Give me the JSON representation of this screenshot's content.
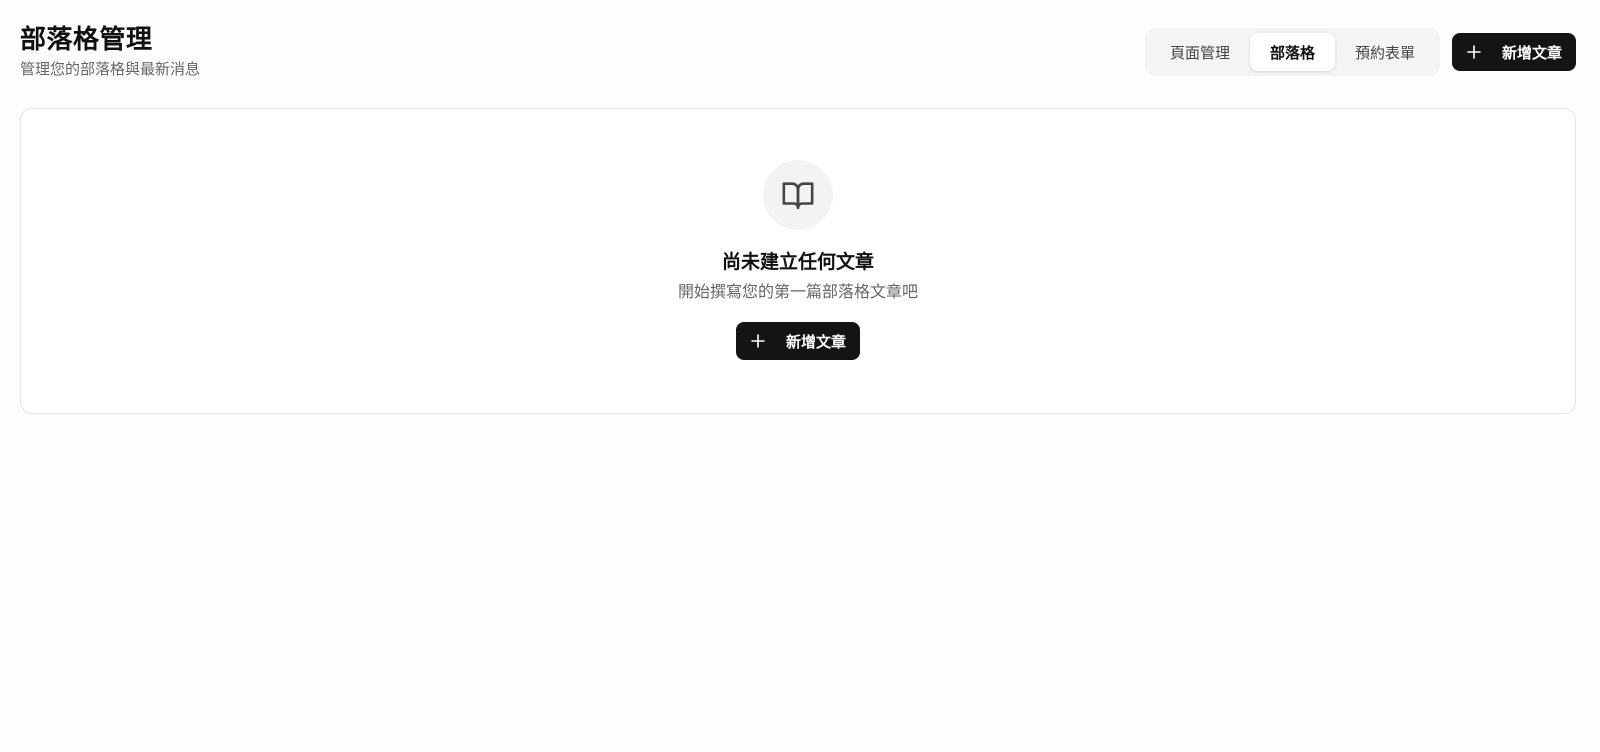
{
  "header": {
    "title": "部落格管理",
    "subtitle": "管理您的部落格與最新消息"
  },
  "tabs": [
    {
      "label": "頁面管理",
      "active": false
    },
    {
      "label": "部落格",
      "active": true
    },
    {
      "label": "預約表單",
      "active": false
    }
  ],
  "toolbar": {
    "new_post_label": "新增文章",
    "new_post_icon": "plus-icon"
  },
  "empty_state": {
    "icon": "book-open-icon",
    "title": "尚未建立任何文章",
    "description": "開始撰寫您的第一篇部落格文章吧",
    "button_label": "新增文章",
    "button_icon": "plus-icon"
  },
  "colors": {
    "primary": "#141414",
    "background": "#fdfdfd",
    "tab_bg": "#f4f4f5",
    "muted_text": "#666666",
    "border": "#e5e5e5"
  }
}
